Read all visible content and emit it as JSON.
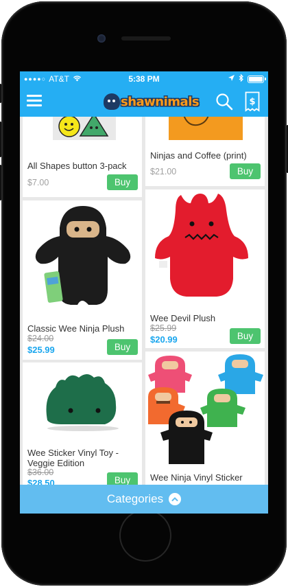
{
  "status_bar": {
    "carrier": "AT&T",
    "time": "5:38 PM",
    "wifi_icon": "wifi-icon",
    "location_icon": "location-arrow-icon",
    "bluetooth_icon": "bluetooth-icon",
    "battery_level": 1.0
  },
  "header": {
    "logo_text": "shawnimals",
    "menu_icon": "hamburger-menu-icon",
    "search_icon": "search-icon",
    "cart_icon": "receipt-dollar-icon",
    "brand_color": "#25aef3"
  },
  "products": [
    {
      "title": "All Shapes button 3-pack",
      "price": "$7.00",
      "buy_label": "Buy"
    },
    {
      "title": "Ninjas and Coffee (print)",
      "price": "$21.00",
      "buy_label": "Buy"
    },
    {
      "title": "Classic Wee Ninja Plush",
      "old_price": "$24.00",
      "price": "$25.99",
      "buy_label": "Buy"
    },
    {
      "title": "Wee Devil Plush",
      "old_price": "$25.99",
      "price": "$20.99",
      "buy_label": "Buy"
    },
    {
      "title": "Wee Sticker Vinyl Toy - Veggie Edition",
      "old_price": "$36.00",
      "price": "$28.50",
      "buy_label": "Buy"
    },
    {
      "title": "Wee Ninja Vinyl Sticker"
    }
  ],
  "footer": {
    "categories_label": "Categories",
    "chevron_icon": "chevron-up-icon",
    "buy_color": "#4dc46f",
    "sale_price_color": "#1aa6ee"
  }
}
